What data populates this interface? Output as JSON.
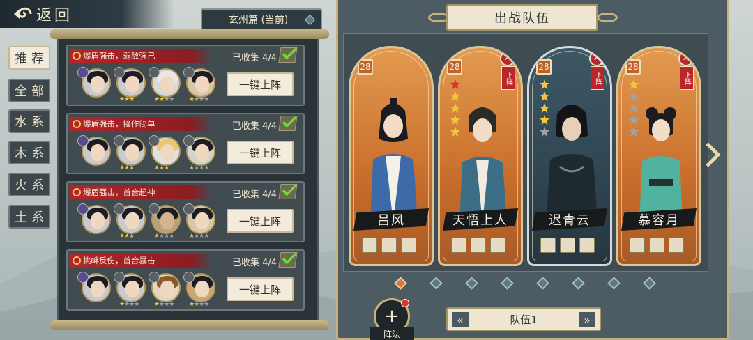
{
  "header": {
    "back_label": "返回",
    "chapter": "玄州篇 (当前)"
  },
  "tabs": [
    "推荐",
    "全部",
    "水系",
    "木系",
    "火系",
    "土系"
  ],
  "lineups": [
    {
      "tag": "爆盾强击，弱敌强己",
      "collected": "已收集 4/4",
      "button": "一键上阵"
    },
    {
      "tag": "爆盾强击，操作简单",
      "collected": "已收集 4/4",
      "button": "一键上阵"
    },
    {
      "tag": "爆盾强击，首合超神",
      "collected": "已收集 4/4",
      "button": "一键上阵"
    },
    {
      "tag": "挑衅反伤，首合暴击",
      "collected": "已收集 4/4",
      "button": "一键上阵"
    }
  ],
  "team_panel": {
    "title": "出战队伍",
    "heroes": [
      {
        "name": "吕风",
        "level": "28"
      },
      {
        "name": "天悟上人",
        "level": "28",
        "remove_label": "下阵"
      },
      {
        "name": "迟青云",
        "level": "28",
        "remove_label": "下阵"
      },
      {
        "name": "慕容月",
        "level": "28",
        "remove_label": "下阵"
      }
    ],
    "formation_label": "阵法",
    "team_label": "队伍1"
  },
  "colors": {
    "accent_orange": "#e0772f",
    "tag_red": "#b3262a",
    "panel_gold": "#c7b27c"
  }
}
